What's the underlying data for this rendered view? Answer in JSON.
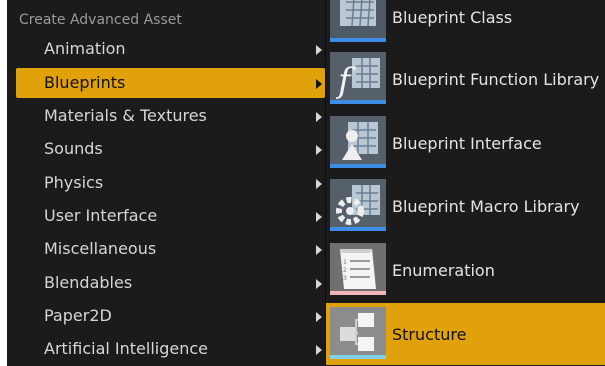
{
  "left_menu": {
    "header": "Create Advanced Asset",
    "items": [
      {
        "label": "Animation"
      },
      {
        "label": "Blueprints"
      },
      {
        "label": "Materials & Textures"
      },
      {
        "label": "Sounds"
      },
      {
        "label": "Physics"
      },
      {
        "label": "User Interface"
      },
      {
        "label": "Miscellaneous"
      },
      {
        "label": "Blendables"
      },
      {
        "label": "Paper2D"
      },
      {
        "label": "Artificial Intelligence"
      }
    ],
    "selected": "Blueprints"
  },
  "right_menu": {
    "items": [
      {
        "label": "Blueprint Class",
        "icon": "blueprint-class-icon"
      },
      {
        "label": "Blueprint Function Library",
        "icon": "function-library-icon"
      },
      {
        "label": "Blueprint Interface",
        "icon": "blueprint-interface-icon"
      },
      {
        "label": "Blueprint Macro Library",
        "icon": "macro-library-icon"
      },
      {
        "label": "Enumeration",
        "icon": "enumeration-icon"
      },
      {
        "label": "Structure",
        "icon": "structure-icon"
      }
    ],
    "selected": "Structure"
  },
  "colors": {
    "menu_background": "#1b1b1b",
    "selection": "#e0a10b",
    "blueprint_strip": "#3d8ce6",
    "enumeration_strip": "#f2b5b5",
    "structure_strip": "#7fd0e6"
  }
}
